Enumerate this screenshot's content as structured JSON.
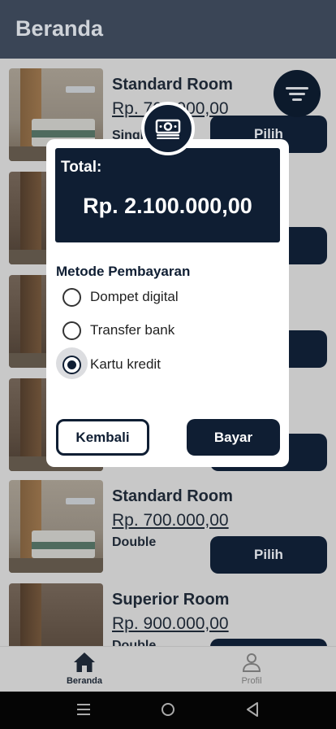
{
  "appbar": {
    "title": "Beranda"
  },
  "rooms": [
    {
      "name": "Standard Room",
      "price": "Rp. 700.000,00",
      "type": "Single",
      "button": "Pilih"
    },
    {
      "name": "Standard Room",
      "price": "Rp. 700.000,00",
      "type": "Double",
      "button": "Pilih"
    },
    {
      "name": "Superior Room",
      "price": "Rp. 900.000,00",
      "type": "Double",
      "button": "Pilih"
    }
  ],
  "fab": {
    "icon": "filter-icon"
  },
  "dialog": {
    "badge_icon": "money-icon",
    "total_label": "Total:",
    "total_value": "Rp. 2.100.000,00",
    "method_title": "Metode Pembayaran",
    "options": [
      {
        "label": "Dompet digital",
        "selected": false
      },
      {
        "label": "Transfer bank",
        "selected": false
      },
      {
        "label": "Kartu kredit",
        "selected": true
      }
    ],
    "back_label": "Kembali",
    "pay_label": "Bayar"
  },
  "bottomnav": {
    "items": [
      {
        "label": "Beranda",
        "icon": "home-icon",
        "active": true
      },
      {
        "label": "Profil",
        "icon": "person-icon",
        "active": false
      }
    ]
  },
  "colors": {
    "primary": "#0f1e33",
    "scrim_bar": "#3a4556",
    "surface": "#ffffff"
  }
}
